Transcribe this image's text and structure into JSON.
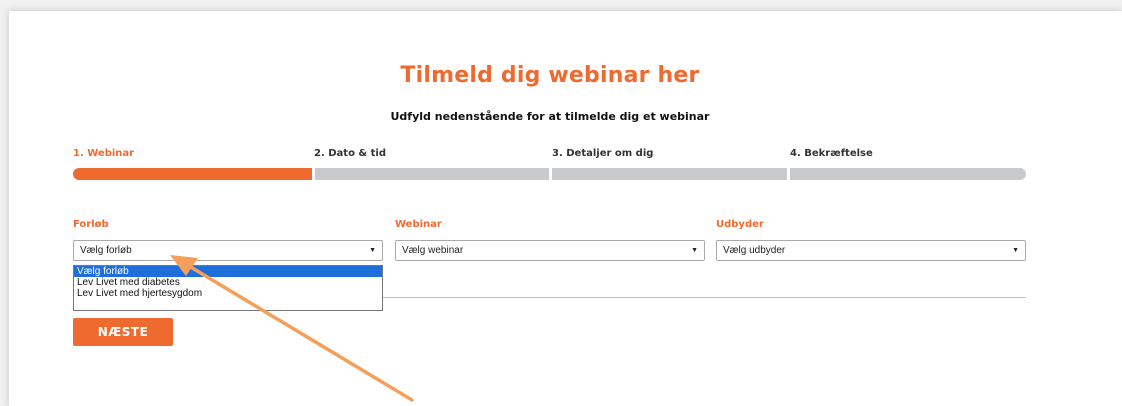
{
  "header": {
    "title": "Tilmeld dig webinar her",
    "subtitle": "Udfyld nedenstående for at tilmelde dig et webinar"
  },
  "steps": [
    {
      "label": "1. Webinar",
      "active": true
    },
    {
      "label": "2. Dato & tid",
      "active": false
    },
    {
      "label": "3. Detaljer om dig",
      "active": false
    },
    {
      "label": "4. Bekræftelse",
      "active": false
    }
  ],
  "form": {
    "forlob": {
      "label": "Forløb",
      "value": "Vælg forløb"
    },
    "webinar": {
      "label": "Webinar",
      "value": "Vælg webinar"
    },
    "udbyder": {
      "label": "Udbyder",
      "value": "Vælg udbyder"
    },
    "dropdown_options": [
      "Vælg forløb",
      "Lev Livet med diabetes",
      "Lev Livet med hjertesygdom"
    ],
    "dropdown_arrow": "▼",
    "next_label": "NÆSTE"
  },
  "colors": {
    "accent": "#ef6a2f",
    "inactive_bar": "#c8cacc",
    "selection": "#1e6fd9",
    "annotation_arrow": "#f4a05a"
  }
}
